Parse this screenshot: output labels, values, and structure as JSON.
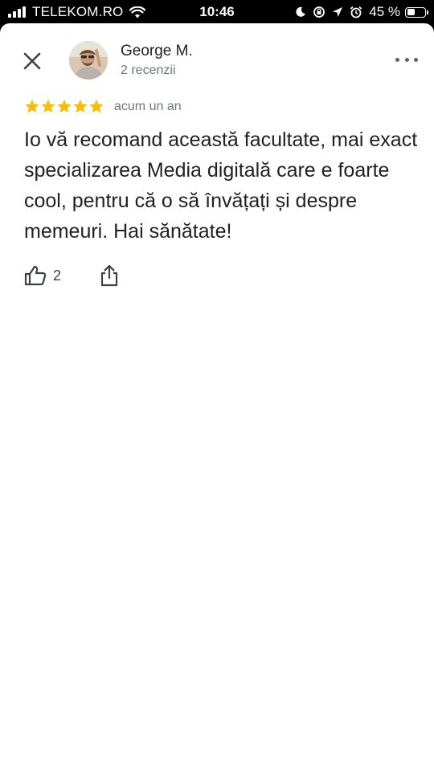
{
  "status_bar": {
    "carrier": "TELEKOM.RO",
    "time": "10:46",
    "battery_percent_label": "45 %",
    "battery_level": 0.45,
    "icons": [
      "signal-icon",
      "wifi-icon",
      "moon-icon",
      "rotation-lock-icon",
      "location-arrow-icon",
      "alarm-icon",
      "battery-icon"
    ]
  },
  "review": {
    "author_name": "George M.",
    "author_meta": "2 recenzii",
    "rating": 5,
    "rating_max": 5,
    "date": "acum un an",
    "text": "Io vă recomand această facultate, mai exact specializarea Media digitală care e foarte cool, pentru că o să învățați și despre memeuri. Hai sănătate!",
    "like_count": "2"
  },
  "icons": {
    "close": "close-icon",
    "more": "more-horizontal-icon",
    "like": "thumbs-up-icon",
    "share": "share-icon",
    "star": "star-icon"
  },
  "colors": {
    "star": "#fbbc04",
    "text_primary": "#202124",
    "text_secondary": "#70757a",
    "icon": "#3c4043"
  }
}
